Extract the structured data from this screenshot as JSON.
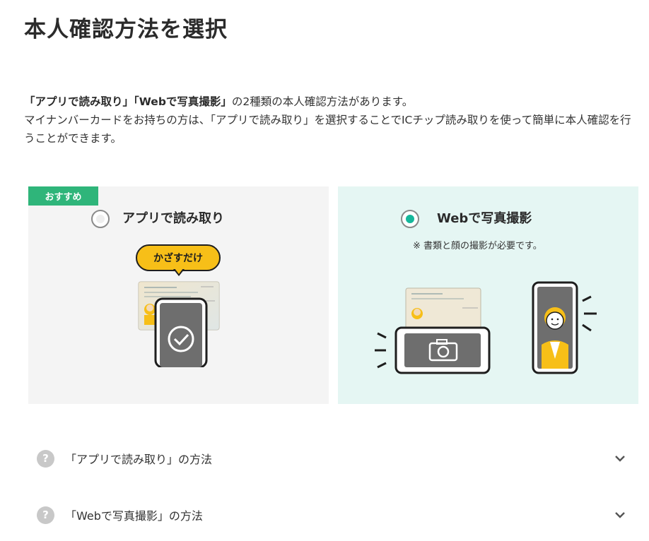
{
  "page": {
    "title": "本人確認方法を選択"
  },
  "intro": {
    "bold_app": "「アプリで読み取り」",
    "bold_web": "「Webで写真撮影」",
    "line1_rest": "の2種類の本人確認方法があります。",
    "line2": "マイナンバーカードをお持ちの方は、「アプリで読み取り」を選択することでICチップ読み取りを使って簡単に本人確認を行うことができます。"
  },
  "options": {
    "app": {
      "badge": "おすすめ",
      "label": "アプリで読み取り",
      "bubble": "かざすだけ",
      "selected": false
    },
    "web": {
      "label": "Webで写真撮影",
      "note": "※ 書類と顔の撮影が必要です。",
      "selected": true
    }
  },
  "faq": [
    {
      "icon": "?",
      "label": "「アプリで読み取り」の方法"
    },
    {
      "icon": "?",
      "label": "「Webで写真撮影」の方法"
    }
  ],
  "colors": {
    "accent_green": "#2fb57a",
    "radio_selected": "#16b79b",
    "bubble_yellow": "#f7bf18",
    "card_app_bg": "#f4f4f4",
    "card_web_bg": "#e5f6f3"
  }
}
